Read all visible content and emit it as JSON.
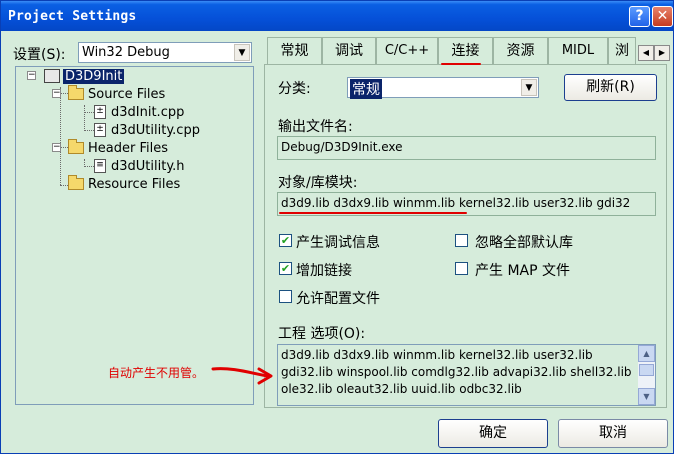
{
  "window": {
    "title": "Project Settings"
  },
  "titlebar": {
    "help_glyph": "?",
    "close_glyph": "✕"
  },
  "left": {
    "settings_label": "设置(S):",
    "config_value": "Win32 Debug",
    "tree": {
      "project": "D3D9Init",
      "source_folder": "Source Files",
      "source_files": [
        "d3dInit.cpp",
        "d3dUtility.cpp"
      ],
      "header_folder": "Header Files",
      "header_files": [
        "d3dUtility.h"
      ],
      "resource_folder": "Resource Files"
    },
    "annotation": "自动产生不用管。"
  },
  "tabs": [
    "常规",
    "调试",
    "C/C++",
    "连接",
    "资源",
    "MIDL",
    "浏"
  ],
  "active_tab": "连接",
  "link": {
    "category_label": "分类:",
    "category_value": "常规",
    "refresh_button": "刷新(R)",
    "output_label": "输出文件名:",
    "output_value": "Debug/D3D9Init.exe",
    "modules_label": "对象/库模块:",
    "modules_value": "d3d9.lib d3dx9.lib winmm.lib kernel32.lib user32.lib gdi32",
    "checkboxes": [
      {
        "label": "产生调试信息",
        "checked": true
      },
      {
        "label": "忽略全部默认库",
        "checked": false
      },
      {
        "label": "增加链接",
        "checked": true
      },
      {
        "label": "产生 MAP 文件",
        "checked": false
      },
      {
        "label": "允许配置文件",
        "checked": false
      }
    ],
    "options_label": "工程 选项(O):",
    "options_text": "d3d9.lib d3dx9.lib winmm.lib kernel32.lib user32.lib gdi32.lib winspool.lib comdlg32.lib advapi32.lib shell32.lib ole32.lib oleaut32.lib uuid.lib odbc32.lib"
  },
  "footer": {
    "ok": "确定",
    "cancel": "取消"
  },
  "colors": {
    "titlebar": "#0550d8",
    "panel_bg": "#d6ecdb",
    "annotation": "#e00000"
  },
  "icons": [
    "help-icon",
    "close-icon",
    "folder-icon",
    "file-icon",
    "project-icon",
    "checkmark-icon"
  ]
}
